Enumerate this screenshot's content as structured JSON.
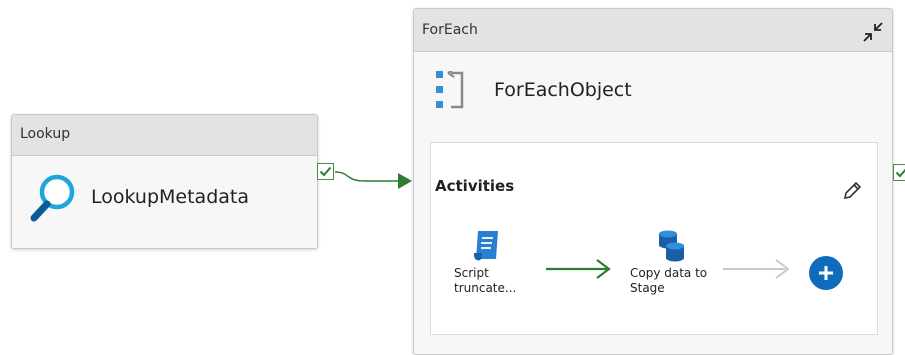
{
  "lookup": {
    "type_label": "Lookup",
    "name": "LookupMetadata",
    "icon": "magnifier-icon"
  },
  "foreach": {
    "type_label": "ForEach",
    "name": "ForEachObject",
    "icon": "foreach-bracket-icon",
    "activities": {
      "label": "Activities",
      "items": [
        {
          "name": "Script truncate...",
          "icon": "script-icon"
        },
        {
          "name": "Copy data to Stage",
          "icon": "database-copy-icon"
        }
      ]
    }
  },
  "colors": {
    "header_bg": "#e3e3e3",
    "body_bg": "#f7f7f7",
    "success_green": "#2e7d32",
    "accent_blue": "#0f6cbd",
    "pending_gray": "#c8c8c8"
  }
}
